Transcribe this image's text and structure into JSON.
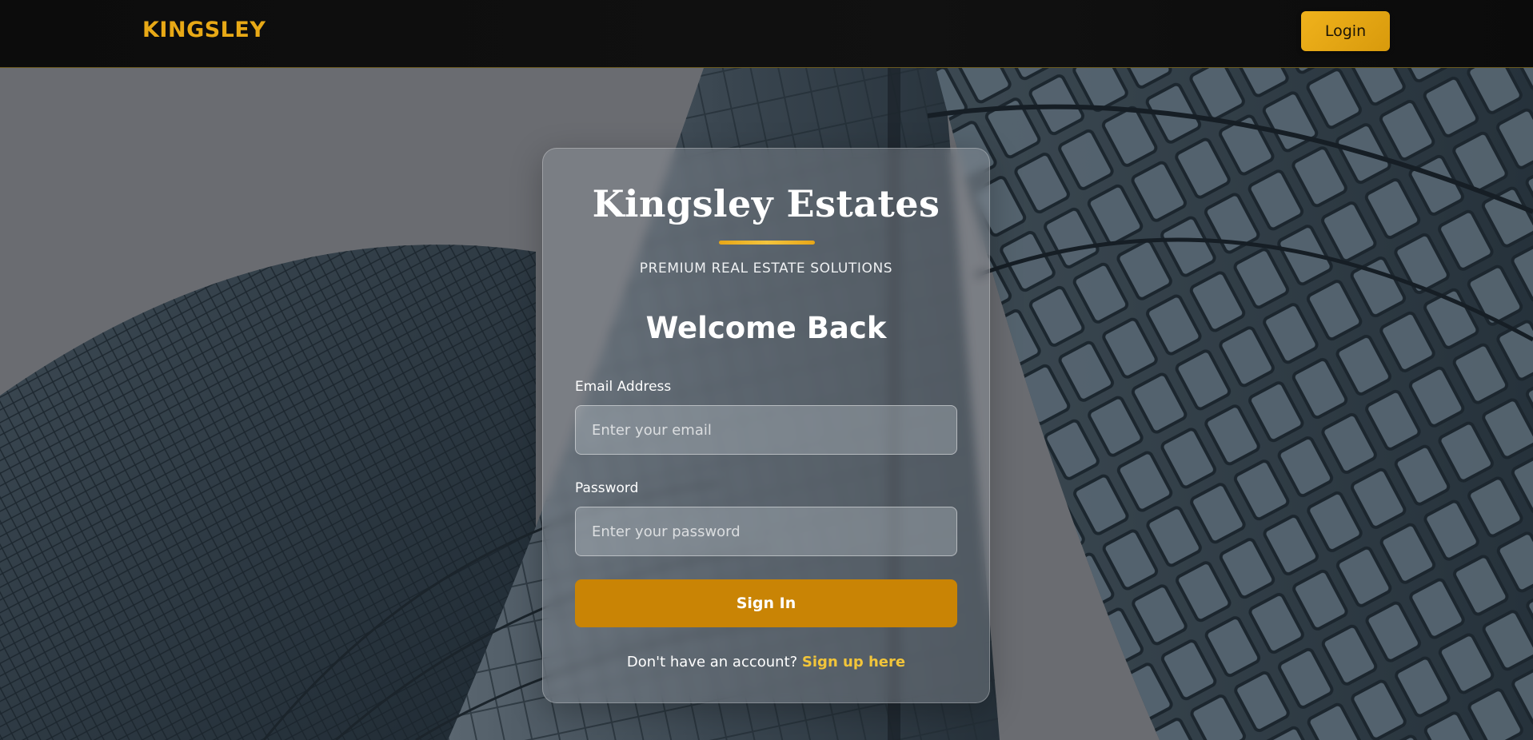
{
  "navbar": {
    "brand": "KINGSLEY",
    "login_label": "Login"
  },
  "card": {
    "title": "Kingsley Estates",
    "tagline": "PREMIUM REAL ESTATE SOLUTIONS",
    "heading": "Welcome Back",
    "email": {
      "label": "Email Address",
      "placeholder": "Enter your email",
      "value": ""
    },
    "password": {
      "label": "Password",
      "placeholder": "Enter your password",
      "value": ""
    },
    "signin_label": "Sign In",
    "signup_prompt": "Don't have an account?",
    "signup_link": "Sign up here"
  },
  "colors": {
    "accent": "#e8a916",
    "button": "#c98405",
    "link": "#f2c53a",
    "navbar_bg": "#0c0c0c"
  },
  "background": {
    "image": "skyscraper-photo"
  }
}
